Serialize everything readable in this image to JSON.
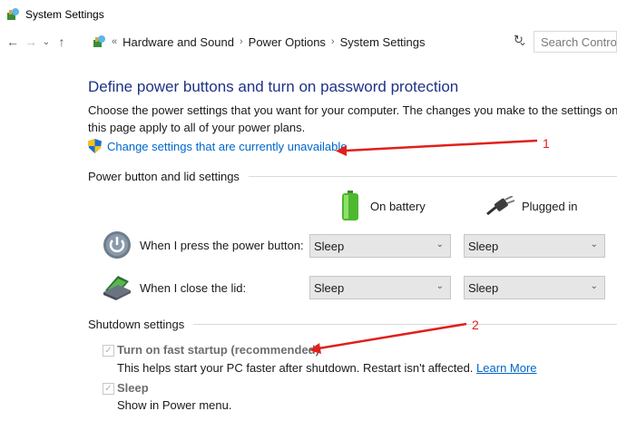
{
  "window": {
    "title": "System Settings"
  },
  "nav": {
    "back": "←",
    "forward": "→",
    "recent": "⌄",
    "up": "↑",
    "breadcrumb_sep": "«",
    "arrow_sep": "›",
    "crumbs": [
      "Hardware and Sound",
      "Power Options",
      "System Settings"
    ],
    "dropdown": "⌄",
    "refresh": "↻",
    "search_placeholder": "Search Control"
  },
  "main": {
    "heading": "Define power buttons and turn on password protection",
    "description": "Choose the power settings that you want for your computer. The changes you make to the settings on this page apply to all of your power plans.",
    "change_link": "Change settings that are currently unavailable"
  },
  "power_group": {
    "header": "Power button and lid settings",
    "col_battery": "On battery",
    "col_plugged": "Plugged in",
    "rows": [
      {
        "label": "When I press the power button:",
        "battery": "Sleep",
        "plugged": "Sleep"
      },
      {
        "label": "When I close the lid:",
        "battery": "Sleep",
        "plugged": "Sleep"
      }
    ]
  },
  "shutdown_group": {
    "header": "Shutdown settings",
    "options": [
      {
        "label": "Turn on fast startup (recommended)",
        "desc": "This helps start your PC faster after shutdown. Restart isn't affected.",
        "link": "Learn More",
        "checked": true
      },
      {
        "label": "Sleep",
        "desc": "Show in Power menu.",
        "checked": true
      }
    ]
  },
  "annotations": {
    "one": "1",
    "two": "2",
    "color": "#e0201a"
  },
  "colors": {
    "heading": "#1e3287",
    "link": "#0066cc"
  }
}
